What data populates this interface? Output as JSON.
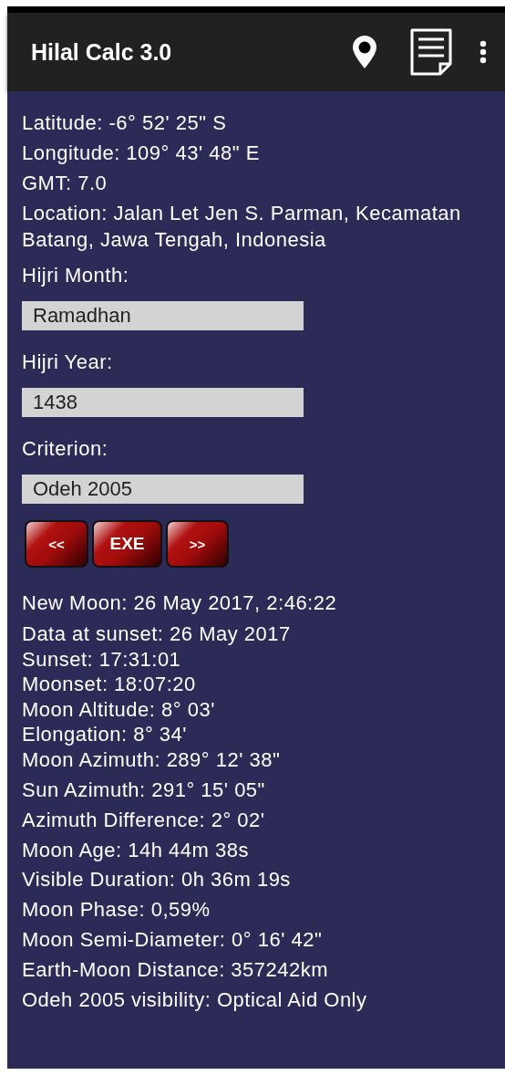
{
  "app_bar": {
    "title": "Hilal Calc 3.0"
  },
  "info": [
    "Latitude: -6° 52' 25\" S",
    "Longitude: 109° 43' 48\" E",
    "GMT: 7.0",
    "Location: Jalan Let Jen S. Parman, Kecamatan Batang, Jawa Tengah, Indonesia"
  ],
  "fields": [
    {
      "label": "Hijri Month:",
      "value": "Ramadhan"
    },
    {
      "label": "Hijri Year:",
      "value": "1438"
    },
    {
      "label": "Criterion:",
      "value": "Odeh 2005"
    }
  ],
  "buttons": [
    "<<",
    "EXE",
    ">>"
  ],
  "result_groups": [
    {
      "lines": [
        "New Moon: 26 May 2017, 2:46:22"
      ]
    },
    {
      "lines": [
        "Data at sunset: 26 May 2017",
        "Sunset: 17:31:01",
        "Moonset: 18:07:20",
        "Moon Altitude: 8° 03'",
        "Elongation: 8° 34'",
        "Moon Azimuth: 289° 12' 38\""
      ]
    },
    {
      "lines": [
        "Sun Azimuth: 291° 15' 05\"",
        "Azimuth Difference: 2° 02'",
        "Moon Age: 14h 44m 38s",
        "Visible Duration: 0h 36m 19s",
        "Moon Phase: 0,59%",
        "Moon Semi-Diameter: 0° 16' 42\"",
        "Earth-Moon Distance: 357242km",
        "Odeh 2005 visibility: Optical Aid Only"
      ]
    }
  ]
}
